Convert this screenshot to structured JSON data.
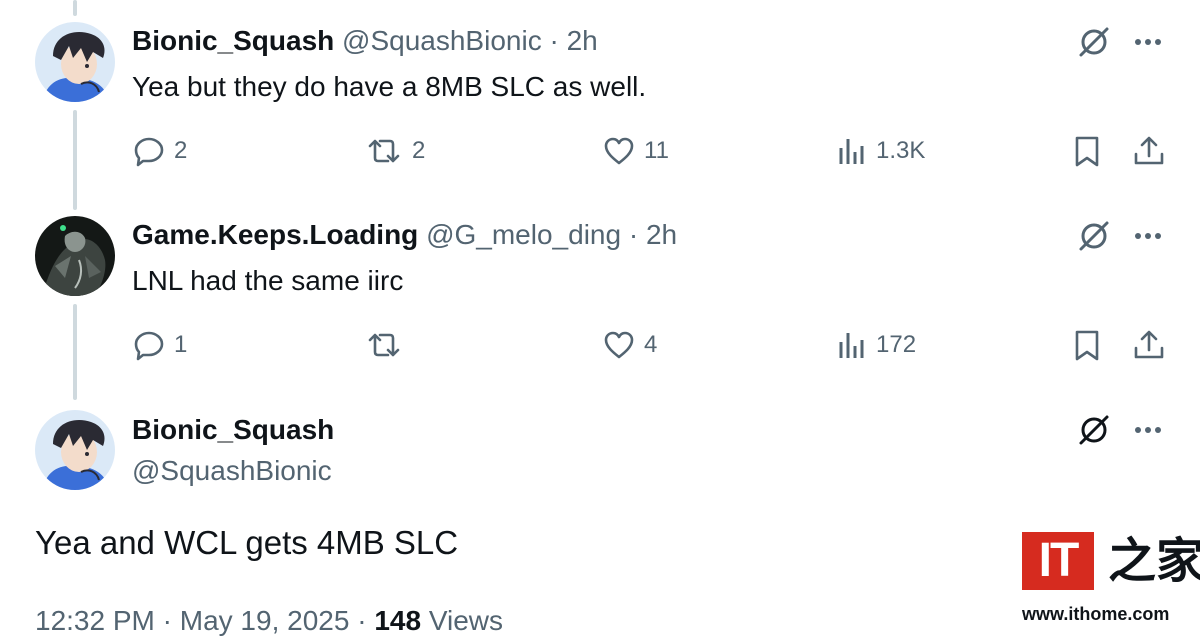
{
  "replies": [
    {
      "display_name": "Bionic_Squash",
      "handle": "@SquashBionic",
      "separator": "·",
      "time": "2h",
      "text": "Yea but they do have a 8MB SLC as well.",
      "counts": {
        "replies": "2",
        "reposts": "2",
        "likes": "11",
        "views": "1.3K"
      }
    },
    {
      "display_name": "Game.Keeps.Loading",
      "handle": "@G_melo_ding",
      "separator": "·",
      "time": "2h",
      "text": "LNL had the same iirc",
      "counts": {
        "replies": "1",
        "reposts": "",
        "likes": "4",
        "views": "172"
      }
    }
  ],
  "main_tweet": {
    "display_name": "Bionic_Squash",
    "handle": "@SquashBionic",
    "text": "Yea and WCL gets 4MB SLC",
    "time": "12:32 PM",
    "separator1": "·",
    "date": "May 19, 2025",
    "separator2": "·",
    "views_count": "148",
    "views_label": "Views"
  },
  "watermark": {
    "logo_text": "IT",
    "logo_cn": "之家",
    "url": "www.ithome.com"
  },
  "colors": {
    "text_primary": "#0f1419",
    "text_secondary": "#536471",
    "thread_line": "#cfd9de",
    "watermark_red": "#d62b1f"
  },
  "icons": {
    "reply": "reply-icon",
    "repost": "repost-icon",
    "like": "heart-icon",
    "views": "analytics-icon",
    "bookmark": "bookmark-icon",
    "share": "share-icon",
    "grok": "grok-icon",
    "more": "more-icon"
  }
}
